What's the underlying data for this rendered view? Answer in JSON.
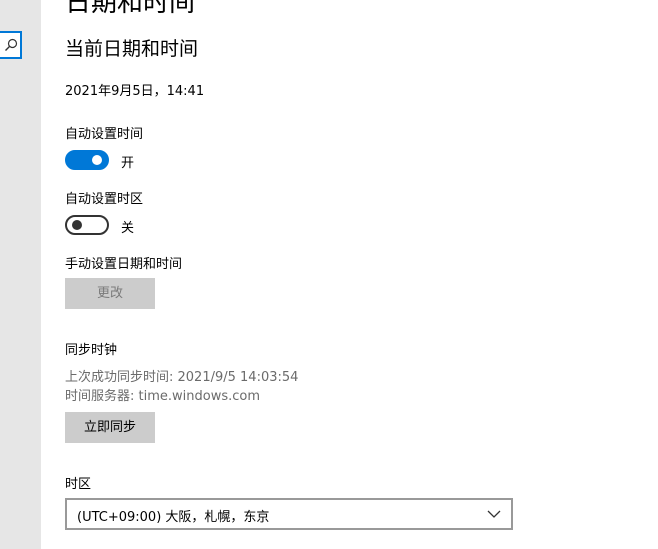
{
  "header": {
    "title": "日期和时间"
  },
  "current": {
    "section_title": "当前日期和时间",
    "datetime": "2021年9月5日，14:41"
  },
  "auto_time": {
    "label": "自动设置时间",
    "state": "开",
    "on": true
  },
  "auto_timezone": {
    "label": "自动设置时区",
    "state": "关",
    "on": false
  },
  "manual": {
    "label": "手动设置日期和时间",
    "button": "更改"
  },
  "sync": {
    "title": "同步时钟",
    "last_sync": "上次成功同步时间: 2021/9/5 14:03:54",
    "server": "时间服务器: time.windows.com",
    "button": "立即同步"
  },
  "timezone": {
    "label": "时区",
    "selected": "(UTC+09:00) 大阪，札幌，东京"
  },
  "colors": {
    "accent": "#0078d7",
    "button_bg": "#cccccc",
    "strip_bg": "#e6e6e6"
  }
}
